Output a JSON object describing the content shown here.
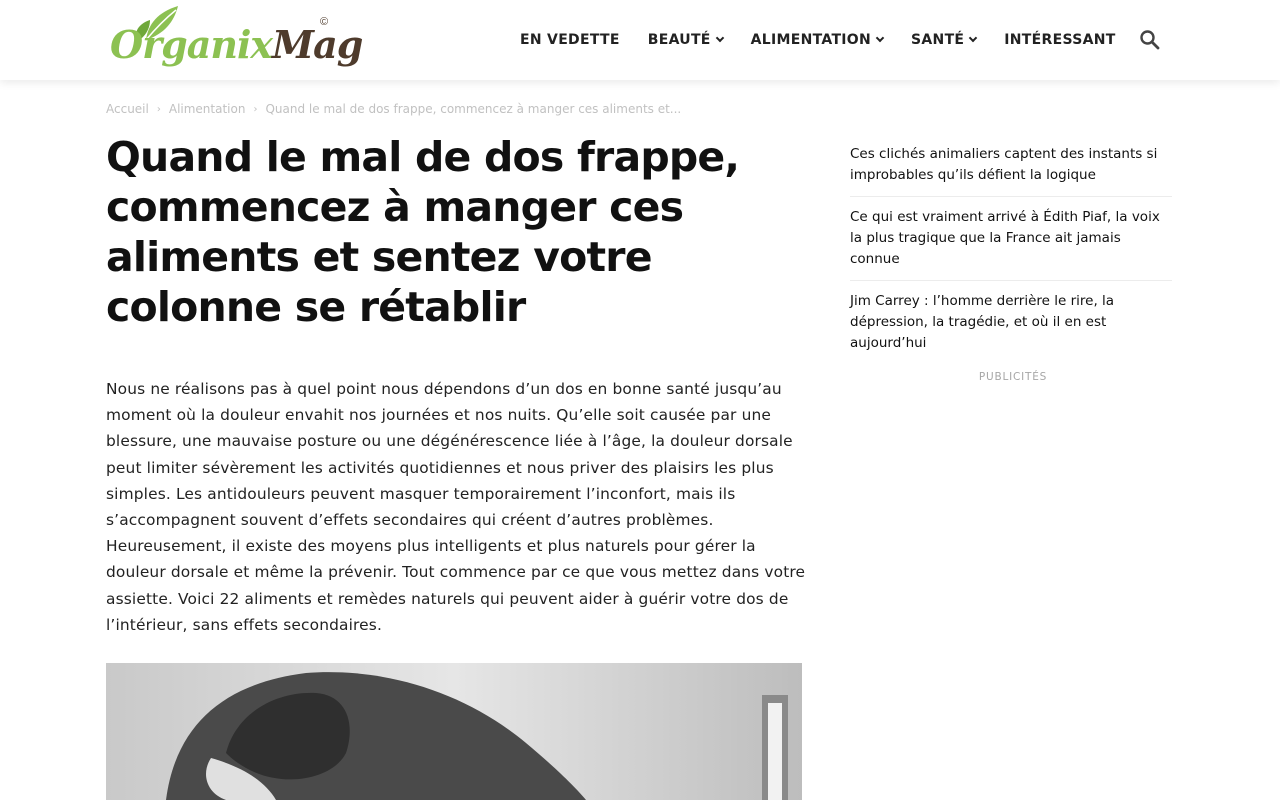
{
  "header": {
    "logo": {
      "word1": "Organix",
      "word2": "Mag",
      "copyright": "©"
    },
    "nav": [
      {
        "label": "EN VEDETTE",
        "has_dropdown": false
      },
      {
        "label": "BEAUTÉ",
        "has_dropdown": true
      },
      {
        "label": "ALIMENTATION",
        "has_dropdown": true
      },
      {
        "label": "SANTÉ",
        "has_dropdown": true
      },
      {
        "label": "INTÉRESSANT",
        "has_dropdown": false
      }
    ],
    "search_icon": "search-icon"
  },
  "breadcrumb": {
    "home": "Accueil",
    "category": "Alimentation",
    "current": "Quand le mal de dos frappe, commencez à manger ces aliments et..."
  },
  "article": {
    "title": "Quand le mal de dos frappe, commencez à manger ces aliments et sentez votre colonne se rétablir",
    "intro": "Nous ne réalisons pas à quel point nous dépendons d’un dos en bonne santé jusqu’au moment où la douleur envahit nos journées et nos nuits. Qu’elle soit causée par une blessure, une mauvaise posture ou une dégénérescence liée à l’âge, la douleur dorsale peut limiter sévèrement les activités quotidiennes et nous priver des plaisirs les plus simples. Les antidouleurs peuvent masquer temporairement l’inconfort, mais ils s’accompagnent souvent d’effets secondaires qui créent d’autres problèmes. Heureusement, il existe des moyens plus intelligents et plus naturels pour gérer la douleur dorsale et même la prévenir. Tout commence par ce que vous mettez dans votre assiette. Voici 22 aliments et remèdes naturels qui peuvent aider à guérir votre dos de l’intérieur, sans effets secondaires."
  },
  "sidebar": {
    "related": [
      "Ces clichés animaliers captent des instants si improbables qu’ils défient la logique",
      "Ce qui est vraiment arrivé à Édith Piaf, la voix la plus tragique que la France ait jamais connue",
      "Jim Carrey : l’homme derrière le rire, la dépression, la tragédie, et où il en est aujourd’hui"
    ],
    "ads_label": "PUBLICITÉS"
  },
  "colors": {
    "logo_green": "#8cc152",
    "logo_brown": "#4e3b2c",
    "text_dark": "#111111",
    "breadcrumb_gray": "#c1c1c1"
  }
}
